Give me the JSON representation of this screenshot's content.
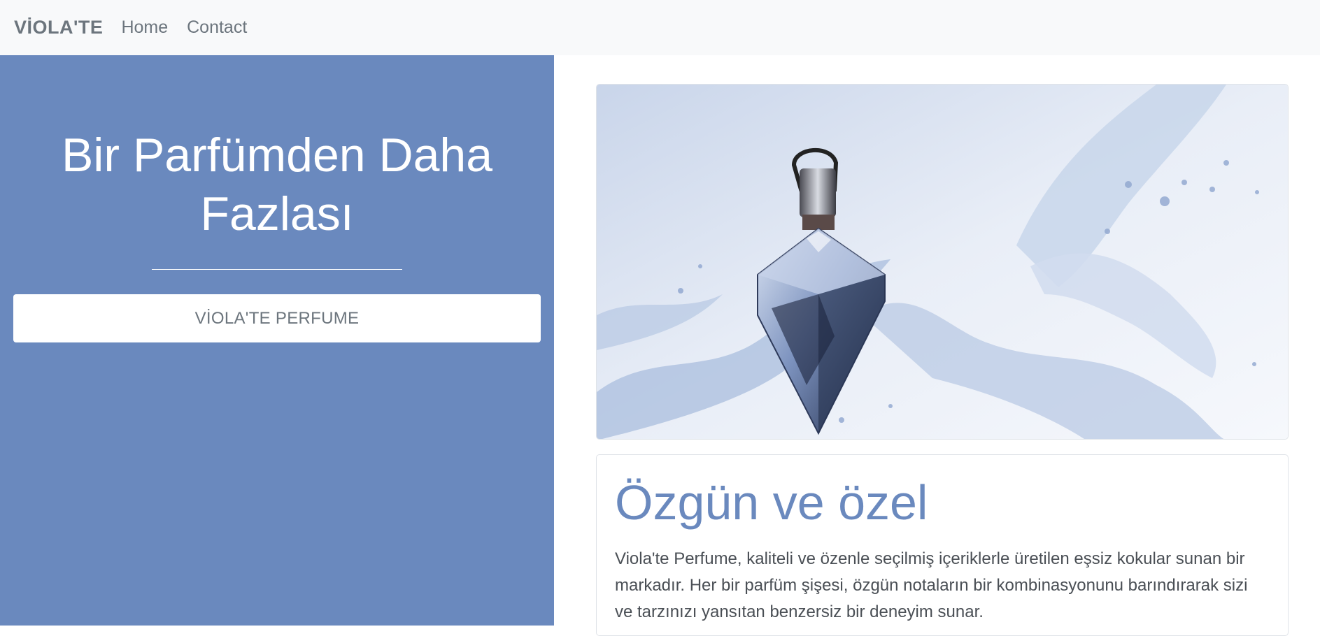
{
  "navbar": {
    "brand": "VİOLA'TE",
    "links": [
      "Home",
      "Contact"
    ]
  },
  "hero": {
    "title": "Bir Parfümden Daha Fazlası",
    "button_label": "VİOLA'TE PERFUME",
    "background_color": "#6a89be"
  },
  "feature_image": {
    "subject": "perfume-bottle-water-splash"
  },
  "card": {
    "title": "Özgün ve özel",
    "text": "Viola'te Perfume, kaliteli ve özenle seçilmiş içeriklerle üretilen eşsiz kokular sunan bir markadır. Her bir parfüm şişesi, özgün notaların bir kombinasyonunu barındırarak sizi ve tarzınızı yansıtan benzersiz bir deneyim sunar."
  },
  "colors": {
    "accent": "#6a89be",
    "navbar_bg": "#f8f9fa",
    "muted_text": "#6c757d"
  }
}
